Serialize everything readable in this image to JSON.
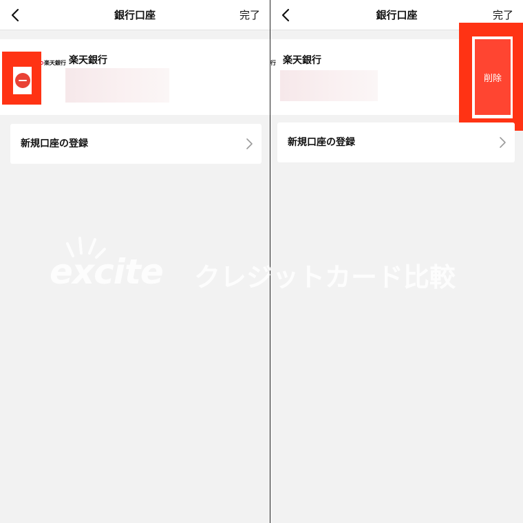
{
  "screens": [
    {
      "nav": {
        "title": "銀行口座",
        "done_label": "完了"
      },
      "account": {
        "logo_text": "楽天銀行",
        "bank_name": "楽天銀行"
      },
      "new_account": {
        "label": "新規口座の登録"
      }
    },
    {
      "nav": {
        "title": "銀行口座",
        "done_label": "完了"
      },
      "account": {
        "logo_text": "行",
        "bank_name": "楽天銀行",
        "delete_label": "削除"
      },
      "new_account": {
        "label": "新規口座の登録"
      }
    }
  ],
  "watermark": {
    "logo": "excite",
    "text": "クレジットカード比較"
  },
  "icons": {
    "back": "chevron-left-icon",
    "row_chevron": "chevron-right-icon",
    "delete_toggle": "minus-circle-icon"
  },
  "colors": {
    "highlight": "#ff3314",
    "delete_button": "#ff4531",
    "minus_circle": "#e94235",
    "background": "#f2f2f2"
  }
}
